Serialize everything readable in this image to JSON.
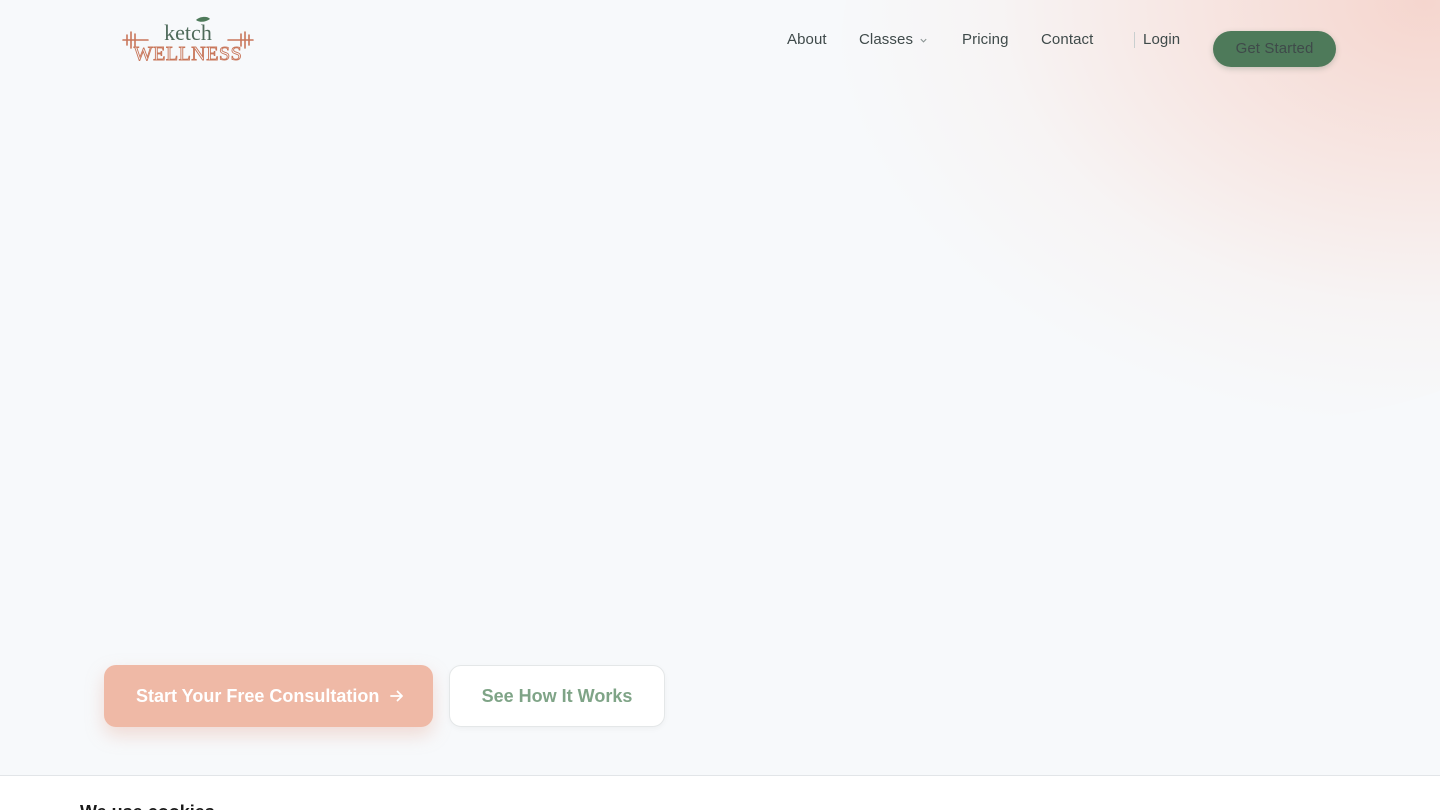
{
  "brand": {
    "logo_top": "ketch",
    "logo_bottom": "WELLNESS"
  },
  "nav": {
    "about": "About",
    "classes": "Classes",
    "pricing": "Pricing",
    "contact": "Contact",
    "login": "Login",
    "get_started": "Get Started"
  },
  "hero": {
    "primary_cta": "Start Your Free Consultation",
    "secondary_cta": "See How It Works"
  },
  "cookie": {
    "title": "We use cookies"
  },
  "colors": {
    "brand_green": "#4e7a5a",
    "accent_peach": "#efb9a6",
    "logo_rust": "#c8765a",
    "secondary_text_green": "#7fa487"
  },
  "icons": {
    "classes_caret": "chevron-down-icon",
    "primary_cta_arrow": "arrow-right-icon",
    "logo_mark": "barbell-icon"
  }
}
